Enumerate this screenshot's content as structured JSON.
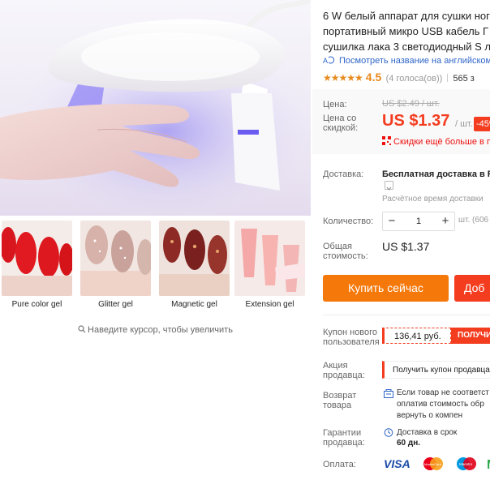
{
  "gallery": {
    "thumbnails": [
      {
        "caption": "Pure color gel"
      },
      {
        "caption": "Glitter gel"
      },
      {
        "caption": "Magnetic gel"
      },
      {
        "caption": "Extension gel"
      }
    ],
    "zoom_hint": "Наведите курсор, чтобы увеличить"
  },
  "product": {
    "title_lines": [
      "6 W белый аппарат для сушки ног",
      "портативный микро USB кабель Г",
      "сушилка лака 3 светодиодный S л"
    ],
    "translate_link": "Посмотреть название на английском",
    "rating": {
      "stars": "★★★★★",
      "value": "4.5",
      "votes": "(4 голоса(ов))",
      "sold": "565 з"
    }
  },
  "pricing": {
    "price_label_1": "Цена:",
    "old_price": "US $2.49 / шт.",
    "discount_price_label_1": "Цена со",
    "discount_price_label_2": "скидкой:",
    "new_price": "US $1.37",
    "per_unit": "/ шт.",
    "discount_badge": "-45%",
    "store_discounts": "Скидки ещё больше в п"
  },
  "shipping": {
    "label": "Доставка:",
    "title": "Бесплатная доставка в Ru",
    "estimate": "Расчётное время доставки"
  },
  "quantity": {
    "label": "Количество:",
    "minus": "−",
    "value": "1",
    "plus": "+",
    "available": "шт. (606"
  },
  "total": {
    "label_1": "Общая",
    "label_2": "стоимость:",
    "value": "US $1.37"
  },
  "actions": {
    "buy_now": "Купить сейчас",
    "add_to_cart": "Доб"
  },
  "coupons": {
    "new_user_label_1": "Купон нового",
    "new_user_label_2": "пользователя",
    "new_user_amount": "136,41 руб.",
    "new_user_get": "ПОЛУЧИ",
    "store_label_1": "Акция",
    "store_label_2": "продавца:",
    "store_get": "Получить купон продавца"
  },
  "returns": {
    "label_1": "Возврат",
    "label_2": "товара",
    "line_1": "Если товар не соответст",
    "line_2": "оплатив стоимость обр",
    "line_3": "вернуть о компен"
  },
  "guarantee": {
    "label_1": "Гарантии",
    "label_2": "продавца:",
    "text": "Доставка в срок",
    "days": "60 дн."
  },
  "payment": {
    "label": "Оплата:",
    "methods": [
      "VISA",
      "MasterCard",
      "Maestro",
      "M"
    ]
  },
  "colors": {
    "accent": "#f43c1f",
    "buy": "#f5780a",
    "link": "#2f66c8",
    "star": "#e8891c"
  }
}
